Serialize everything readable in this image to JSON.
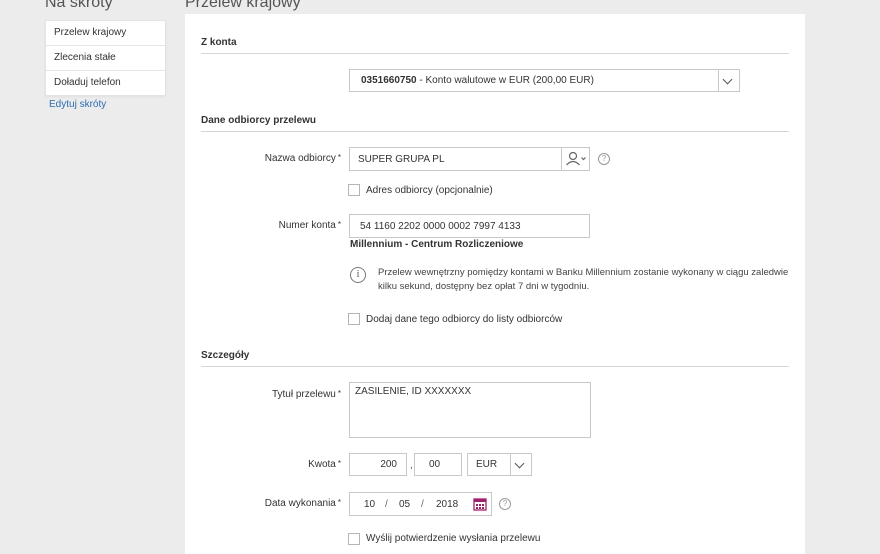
{
  "sidebar": {
    "title": "Na skróty",
    "items": [
      {
        "label": "Przelew krajowy"
      },
      {
        "label": "Zlecenia stałe"
      },
      {
        "label": "Doładuj telefon"
      }
    ],
    "edit_label": "Edytuj skróty"
  },
  "page": {
    "title": "Przelew krajowy"
  },
  "from_account": {
    "section_title": "Z konta",
    "account_number": "0351660750",
    "account_desc": "- Konto walutowe w EUR (200,00 EUR)"
  },
  "recipient": {
    "section_title": "Dane odbiorcy przelewu",
    "name_label": "Nazwa odbiorcy",
    "name_value": "SUPER GRUPA PL",
    "address_label": "Adres odbiorcy (opcjonalnie)",
    "account_label": "Numer konta",
    "account_value": "54 1160 2202 0000 0002 7997 4133",
    "bank_name": "Millennium - Centrum Rozliczeniowe",
    "info_text": "Przelew wewnętrzny pomiędzy kontami w Banku Millennium zostanie wykonany w ciągu zaledwie kilku sekund, dostępny bez opłat 7 dni w tygodniu.",
    "add_to_list_label": "Dodaj dane tego odbiorcy do listy odbiorców"
  },
  "details": {
    "section_title": "Szczegóły",
    "title_label": "Tytuł przelewu",
    "title_value": "ZASILENIE, ID XXXXXXX",
    "amount_label": "Kwota",
    "amount_int": "200",
    "amount_sep": ",",
    "amount_dec": "00",
    "currency": "EUR",
    "date_label": "Data wykonania",
    "date_day": "10",
    "date_month": "05",
    "date_year": "2018",
    "date_sep": "/",
    "confirm_label": "Wyślij potwierdzenie wysłania przelewu"
  },
  "required_mark": "*",
  "help_mark": "?",
  "info_mark": "i",
  "colors": {
    "accent_link": "#2d6bb0",
    "calendar": "#a0206e",
    "background": "#ececec"
  },
  "icons": [
    "chevron-down-icon",
    "contact-book-icon",
    "help-icon",
    "info-icon",
    "calendar-icon"
  ]
}
